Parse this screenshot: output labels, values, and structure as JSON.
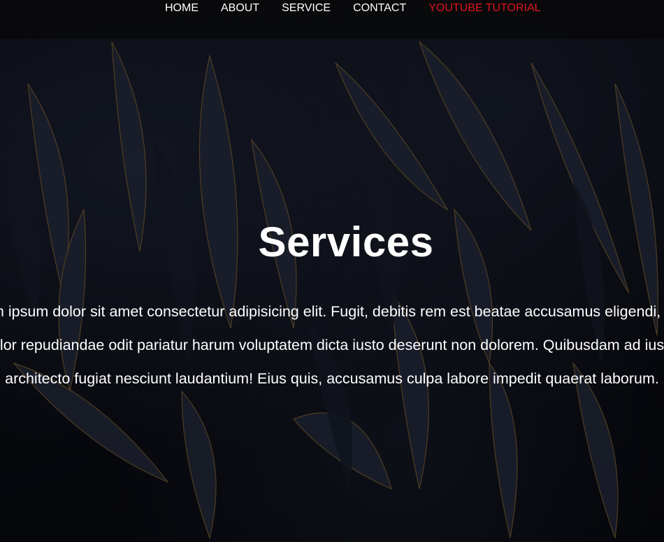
{
  "nav": {
    "items": [
      {
        "label": "HOME"
      },
      {
        "label": "ABOUT"
      },
      {
        "label": "SERVICE"
      },
      {
        "label": "CONTACT"
      },
      {
        "label": "YOUTUBE TUTORIAL",
        "active": true
      }
    ],
    "active_color": "#e0151b"
  },
  "hero": {
    "title": "Services",
    "line1": "Lorem ipsum dolor sit amet consectetur adipisicing elit. Fugit, debitis rem est beatae accusamus eligendi, atque",
    "line2": "dolor repudiandae odit pariatur harum voluptatem dicta iusto deserunt non dolorem. Quibusdam ad iusto,",
    "line3": "architecto fugiat nesciunt laudantium! Eius quis, accusamus culpa labore impedit quaerat laborum."
  },
  "background": {
    "description_icon": "dark-leaves-background",
    "base_color": "#0b0d14"
  }
}
